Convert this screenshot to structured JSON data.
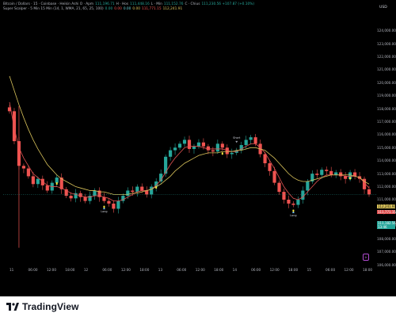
{
  "header": {
    "legend_line1": [
      {
        "text": "Bitcoin / Dollars · 15 · Coinbase · Heikin Ashi O · Apm",
        "color": "grey"
      },
      {
        "text": "111,196.71",
        "color": "green"
      },
      {
        "text": "H · Hos",
        "color": "grey"
      },
      {
        "text": "111,448.16",
        "color": "green"
      },
      {
        "text": "L · Min",
        "color": "grey"
      },
      {
        "text": "111,152.76",
        "color": "green"
      },
      {
        "text": "C · Chius",
        "color": "grey"
      },
      {
        "text": "111,230.56 +107.87 (+0.10%)",
        "color": "green"
      }
    ],
    "legend_line2": [
      {
        "text": "Super Scalper - 5 Min 15 Min (14, 1, WMA, 21, 65, 25, 100)",
        "color": "grey"
      },
      {
        "text": "0.00",
        "color": "green"
      },
      {
        "text": "0.00",
        "color": "red"
      },
      {
        "text": "0.00",
        "color": "cyan"
      },
      {
        "text": "0.00",
        "color": "yellow"
      },
      {
        "text": "111,771.15",
        "color": "red"
      },
      {
        "text": "112,241.91",
        "color": "yellow"
      }
    ],
    "currency": "USD"
  },
  "footer": {
    "brand": "TradingView"
  },
  "price_tags": {
    "yellow": "112,241.91",
    "red": "111,771.15",
    "teal_price": "111,182.56",
    "teal_time": "13:46"
  },
  "annotations": {
    "short_label": "Short",
    "long_label": "Long"
  },
  "colors": {
    "bull": "#26a69a",
    "bear": "#ef5350",
    "ma_yellow": "#d8c25a",
    "ma_red": "#e05252",
    "background": "#000000"
  },
  "chart_data": {
    "type": "candlestick",
    "title": "Bitcoin / Dollars · 15 · Coinbase · Heikin Ashi",
    "ylabel": "USD",
    "ylim": [
      106000,
      125500
    ],
    "y_ticks": [
      {
        "value": 106000,
        "label": "106,000.00"
      },
      {
        "value": 107000,
        "label": "107,000.00"
      },
      {
        "value": 108000,
        "label": "108,000.00"
      },
      {
        "value": 109000,
        "label": "109,000.00"
      },
      {
        "value": 110000,
        "label": "110,000.00"
      },
      {
        "value": 111000,
        "label": "111,000.00"
      },
      {
        "value": 112000,
        "label": "112,000.00"
      },
      {
        "value": 113000,
        "label": "113,000.00"
      },
      {
        "value": 114000,
        "label": "114,000.00"
      },
      {
        "value": 115000,
        "label": "115,000.00"
      },
      {
        "value": 116000,
        "label": "116,000.00"
      },
      {
        "value": 117000,
        "label": "117,000.00"
      },
      {
        "value": 118000,
        "label": "118,000.00"
      },
      {
        "value": 119000,
        "label": "119,000.00"
      },
      {
        "value": 120000,
        "label": "120,000.00"
      },
      {
        "value": 121000,
        "label": "121,000.00"
      },
      {
        "value": 122000,
        "label": "122,000.00"
      },
      {
        "value": 123000,
        "label": "123,000.00"
      },
      {
        "value": 124000,
        "label": "124,000.00"
      }
    ],
    "x_ticks": [
      "11",
      "06:00",
      "12:00",
      "18:00",
      "12",
      "06:00",
      "12:00",
      "18:00",
      "13",
      "06:00",
      "12:00",
      "18:00",
      "14",
      "06:00",
      "12:00",
      "18:00",
      "15",
      "06:00",
      "12:00",
      "18:00"
    ],
    "series": [
      {
        "name": "price",
        "values": [
          117800,
          115500,
          113600,
          113400,
          112800,
          112200,
          112600,
          112100,
          111700,
          112300,
          112700,
          111800,
          111300,
          111100,
          111500,
          111200,
          110900,
          111300,
          111700,
          111200,
          110900,
          110700,
          110300,
          110900,
          111300,
          111700,
          111600,
          112000,
          111700,
          111400,
          112000,
          112400,
          113000,
          114300,
          114800,
          115000,
          115300,
          115600,
          114900,
          115100,
          115400,
          115100,
          114800,
          114700,
          115300,
          115000,
          114500,
          114600,
          114800,
          115200,
          115600,
          115800,
          115300,
          114500,
          113800,
          113200,
          112300,
          111600,
          111000,
          110700,
          110600,
          111000,
          111700,
          112400,
          113000,
          112900,
          113300,
          113200,
          112900,
          113100,
          112800,
          112600,
          113100,
          112800,
          112600,
          111800,
          111400
        ]
      },
      {
        "name": "ma_yellow",
        "values": [
          120500,
          119400,
          118300,
          117300,
          116400,
          115600,
          114900,
          114300,
          113700,
          113300,
          112900,
          112600,
          112400,
          112200,
          112000,
          111900,
          111800,
          111700,
          111700,
          111600,
          111600,
          111500,
          111400,
          111400,
          111400,
          111400,
          111500,
          111500,
          111600,
          111700,
          111800,
          112000,
          112200,
          112500,
          112800,
          113200,
          113500,
          113800,
          114000,
          114200,
          114400,
          114500,
          114600,
          114600,
          114600,
          114700,
          114700,
          114700,
          114800,
          114800,
          114900,
          115000,
          115000,
          114900,
          114800,
          114500,
          114200,
          113800,
          113400,
          113000,
          112700,
          112500,
          112400,
          112400,
          112500,
          112600,
          112700,
          112800,
          112900,
          112900,
          112900,
          112900,
          112900,
          112800,
          112700,
          112400,
          112200
        ]
      },
      {
        "name": "ma_red",
        "values": [
          118500,
          116500,
          115000,
          114200,
          113600,
          113000,
          112700,
          112400,
          112100,
          112000,
          112000,
          111900,
          111700,
          111500,
          111400,
          111300,
          111200,
          111200,
          111300,
          111300,
          111200,
          111100,
          110900,
          110900,
          111000,
          111200,
          111400,
          111600,
          111700,
          111700,
          111800,
          112100,
          112500,
          113100,
          113700,
          114200,
          114600,
          115000,
          115100,
          115100,
          115100,
          115000,
          114900,
          114900,
          114900,
          114900,
          114800,
          114700,
          114700,
          114900,
          115100,
          115300,
          115300,
          115000,
          114600,
          114000,
          113400,
          112700,
          112000,
          111500,
          111100,
          111000,
          111200,
          111600,
          112000,
          112400,
          112700,
          112900,
          112900,
          112900,
          112900,
          112800,
          112800,
          112800,
          112700,
          112300,
          111900
        ]
      }
    ],
    "signals": [
      {
        "type": "short",
        "index": 48,
        "label": "Short"
      },
      {
        "type": "long",
        "index": 20,
        "label": "Long"
      },
      {
        "type": "long",
        "index": 60,
        "label": "Long"
      }
    ],
    "grid": false,
    "legend": "top-left"
  }
}
